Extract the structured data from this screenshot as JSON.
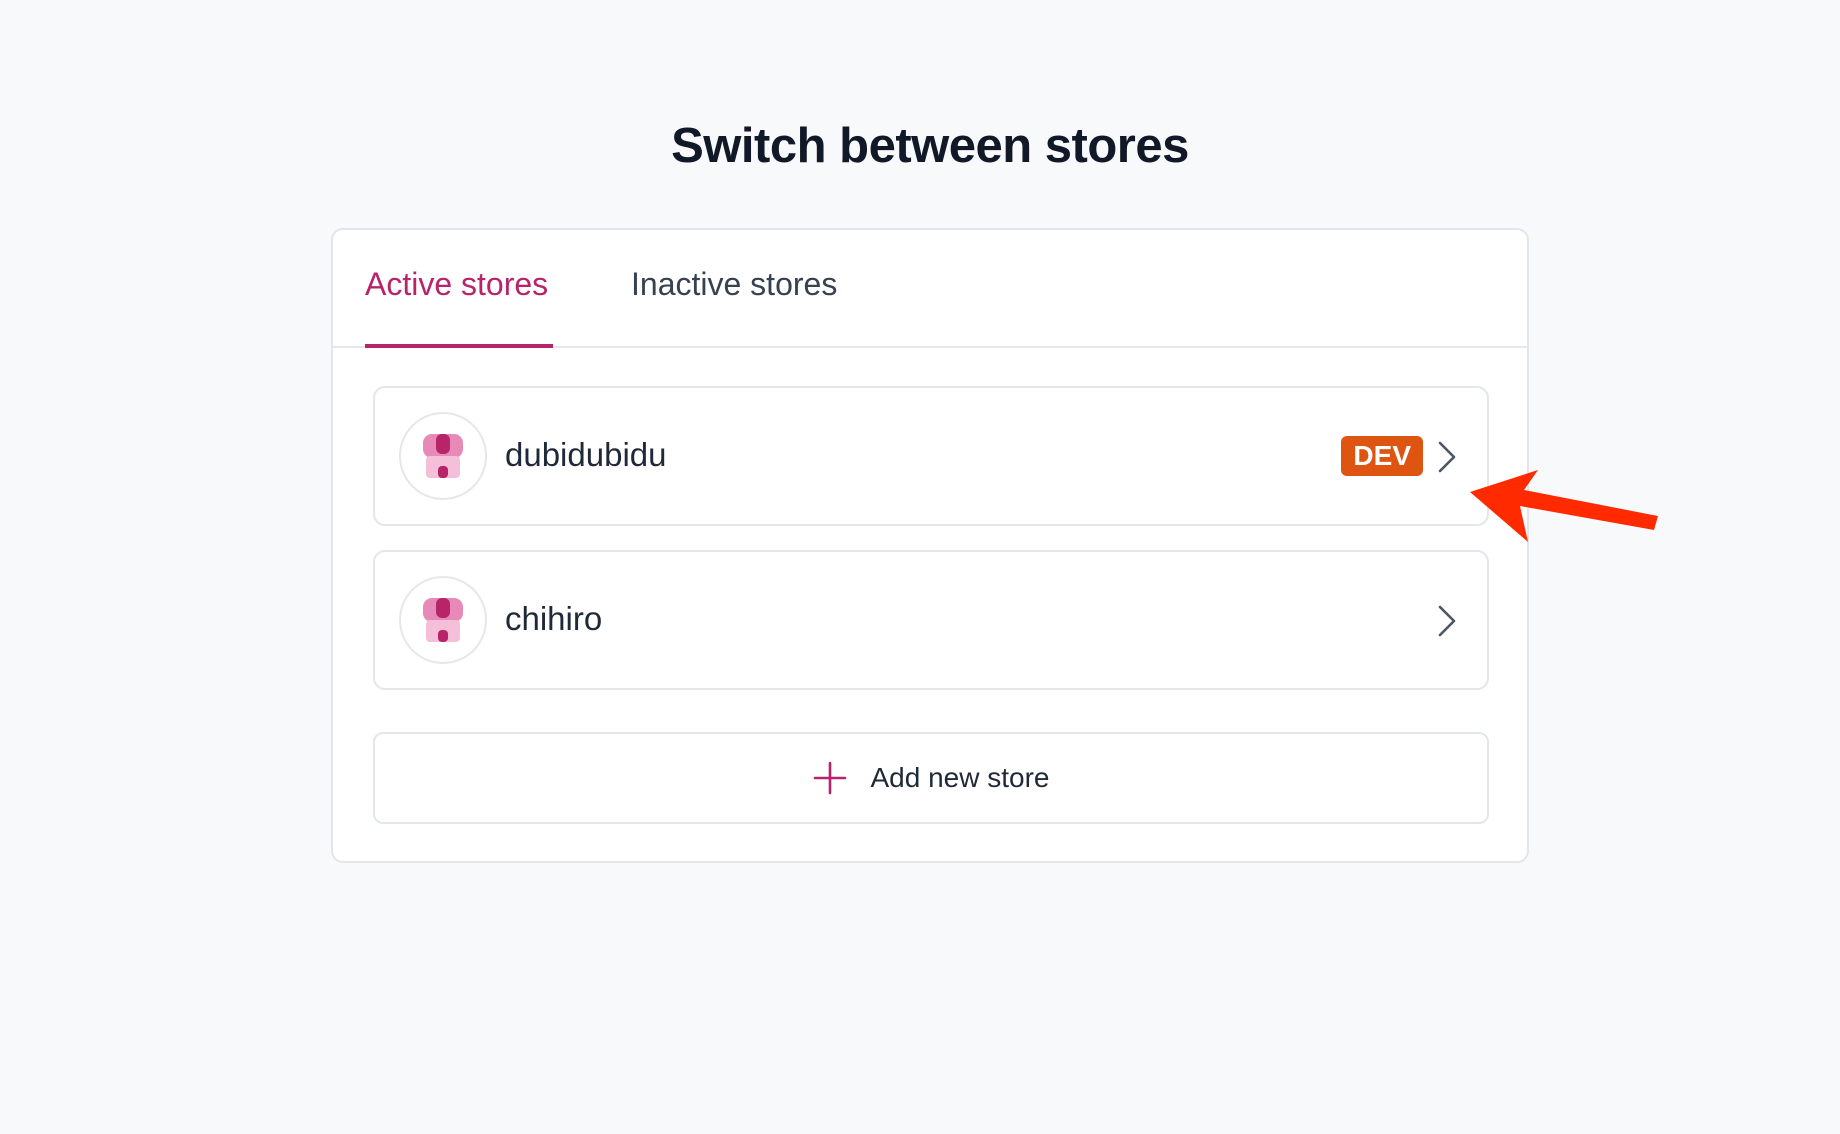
{
  "page": {
    "title": "Switch between stores"
  },
  "tabs": [
    {
      "label": "Active stores",
      "active": true
    },
    {
      "label": "Inactive stores",
      "active": false
    }
  ],
  "stores": [
    {
      "name": "dubidubidu",
      "badge": "DEV",
      "icon": "store-icon"
    },
    {
      "name": "chihiro",
      "badge": "",
      "icon": "store-icon"
    }
  ],
  "add_store": {
    "label": "Add new store",
    "icon": "plus-icon"
  },
  "colors": {
    "accent": "#b8246a",
    "badge_bg": "#dd5510",
    "annotation_arrow": "#ff2a00",
    "background": "#f8f9fb"
  }
}
